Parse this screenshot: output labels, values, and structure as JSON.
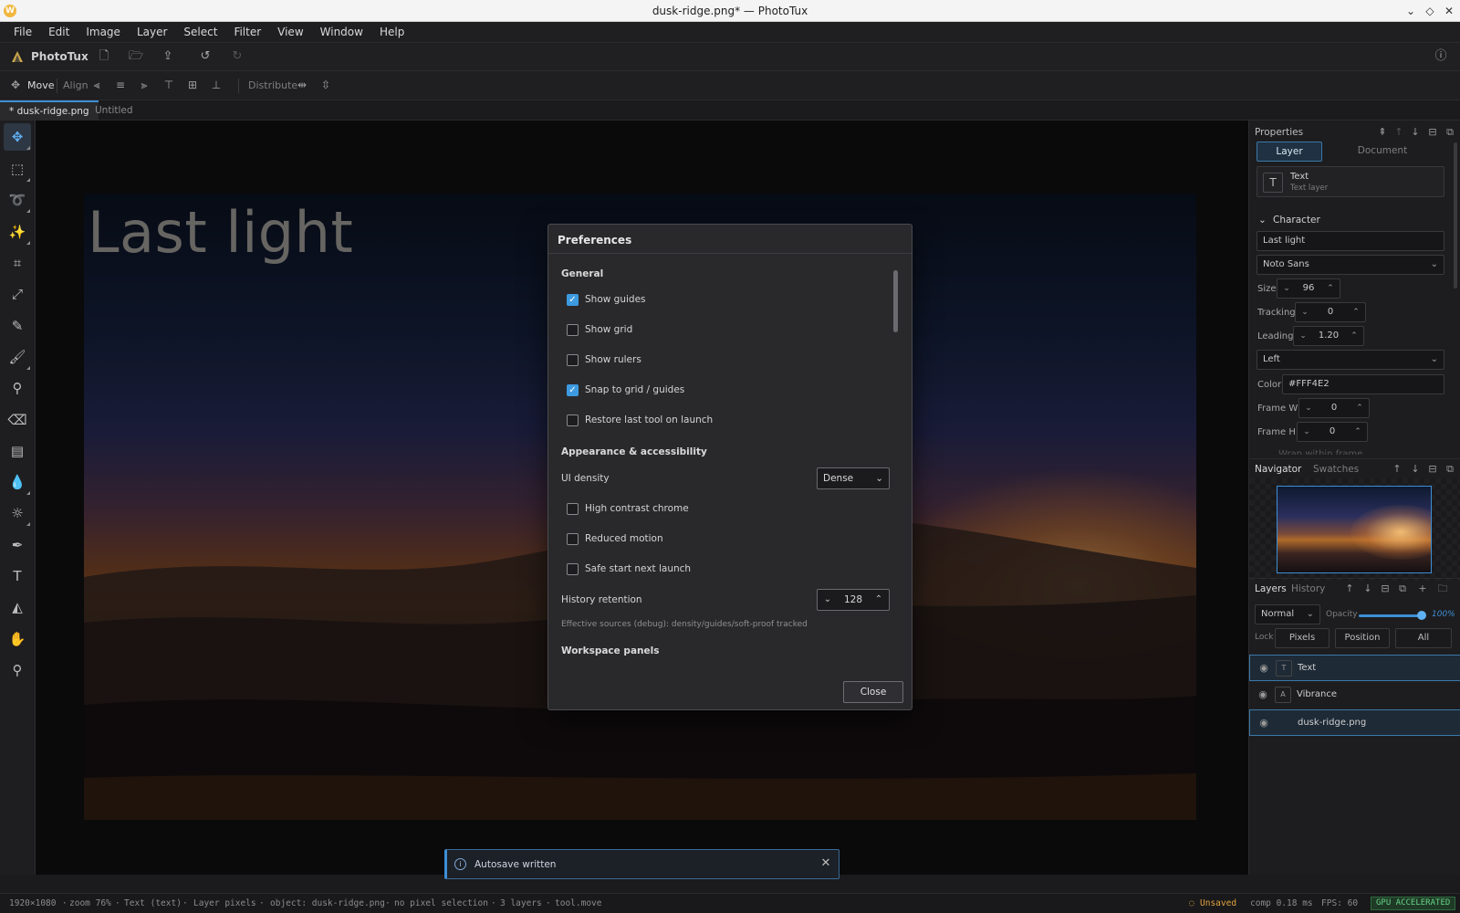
{
  "window": {
    "title": "dusk-ridge.png* — PhotoTux"
  },
  "menubar": [
    "File",
    "Edit",
    "Image",
    "Layer",
    "Select",
    "Filter",
    "View",
    "Window",
    "Help"
  ],
  "app_toolbar": {
    "app_name": "PhotoTux"
  },
  "options_bar": {
    "tool": "Move",
    "align_label": "Align",
    "distribute_label": "Distribute"
  },
  "doc_tabs": [
    {
      "label": "* dusk-ridge.png",
      "active": true
    },
    {
      "label": "Untitled",
      "active": false
    }
  ],
  "canvas": {
    "text_layer_content": "Last light"
  },
  "properties": {
    "title": "Properties",
    "tabs": [
      "Layer",
      "Document"
    ],
    "layer_card": {
      "name": "Text",
      "kind": "Text layer"
    },
    "character_title": "Character",
    "text_value": "Last light",
    "font": "Noto Sans",
    "size_label": "Size",
    "size_value": "96",
    "tracking_label": "Tracking",
    "tracking_value": "0",
    "leading_label": "Leading",
    "leading_value": "1.20",
    "align_value": "Left",
    "color_label": "Color",
    "color_value": "#FFF4E2",
    "frame_w_label": "Frame W",
    "frame_w_value": "0",
    "frame_h_label": "Frame H",
    "frame_h_value": "0",
    "wrap_label": "Wrap within frame"
  },
  "navigator": {
    "tabs": [
      "Navigator",
      "Swatches"
    ]
  },
  "layers_panel": {
    "tabs": [
      "Layers",
      "History"
    ],
    "blend_mode": "Normal",
    "opacity_label": "Opacity",
    "opacity_value": "100%",
    "opacity_fraction": 1.0,
    "lock_label": "Lock",
    "lock_buttons": [
      "Pixels",
      "Position",
      "All"
    ],
    "layers": [
      {
        "name": "Text",
        "thumb": "T",
        "selected": true
      },
      {
        "name": "Vibrance",
        "thumb": "A",
        "selected": false
      },
      {
        "name": "dusk-ridge.png",
        "thumb": "",
        "selected": true
      }
    ]
  },
  "preferences": {
    "title": "Preferences",
    "general_header": "General",
    "general": [
      {
        "label": "Show guides",
        "checked": true
      },
      {
        "label": "Show grid",
        "checked": false
      },
      {
        "label": "Show rulers",
        "checked": false
      },
      {
        "label": "Snap to grid / guides",
        "checked": true
      },
      {
        "label": "Restore last tool on launch",
        "checked": false
      }
    ],
    "appearance_header": "Appearance & accessibility",
    "ui_density_label": "UI density",
    "ui_density_value": "Dense",
    "appearance": [
      {
        "label": "High contrast chrome",
        "checked": false
      },
      {
        "label": "Reduced motion",
        "checked": false
      },
      {
        "label": "Safe start next launch",
        "checked": false
      }
    ],
    "history_label": "History retention",
    "history_value": "128",
    "debug_text": "Effective sources (debug): density/guides/soft-proof tracked",
    "workspace_header": "Workspace panels",
    "close_label": "Close"
  },
  "toast": {
    "message": "Autosave written"
  },
  "statusbar": {
    "items": [
      "1920×1080",
      "zoom 76%",
      "Text (text)",
      "Layer pixels",
      "object: dusk-ridge.png",
      "no pixel selection",
      "3 layers",
      "tool.move"
    ],
    "unsaved": "Unsaved",
    "comp": "comp 0.18 ms",
    "fps": "FPS: 60",
    "gpu": "GPU ACCELERATED"
  },
  "colors": {
    "accent": "#3d8fd6",
    "checkbox_checked": "#3d9ae0",
    "warning": "#e0a23c",
    "gpu_ok": "#67d487"
  }
}
